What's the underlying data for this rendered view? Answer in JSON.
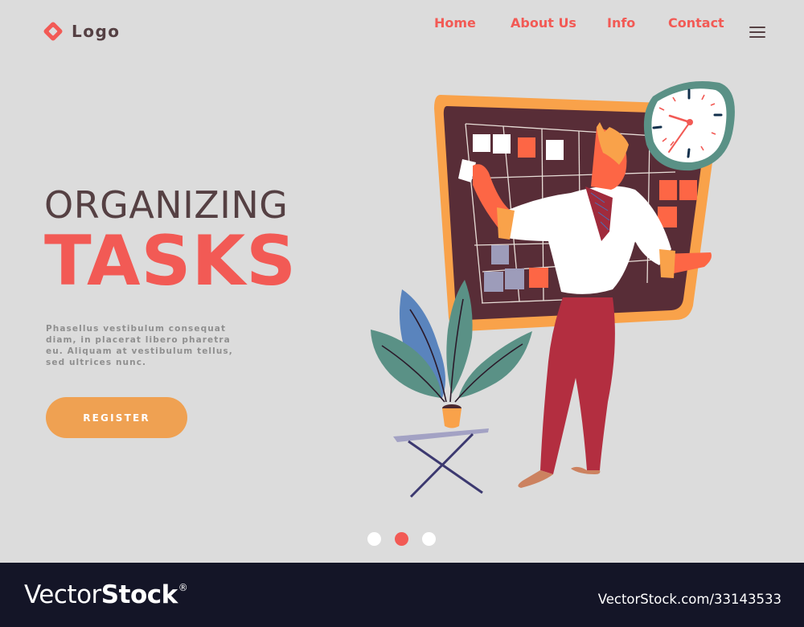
{
  "header": {
    "logo_text": "Logo",
    "nav": [
      {
        "label": "Home"
      },
      {
        "label": "About Us"
      },
      {
        "label": "Info"
      },
      {
        "label": "Contact"
      }
    ],
    "menu_icon": "hamburger-menu-icon"
  },
  "hero": {
    "title_line1": "ORGANIZING",
    "title_line2": "TASKS",
    "description": "Phasellus vestibulum consequat diam, in placerat libero pharetra eu. Aliquam at vestibulum tellus, sed ultrices nunc.",
    "cta_label": "REGISTER"
  },
  "carousel": {
    "slides": 3,
    "active_index": 1
  },
  "illustration": {
    "subject": "man arranging sticky notes on a task board next to a wall clock and potted plant",
    "clock_time": "approximately 8:35"
  },
  "footer": {
    "brand_light": "Vector",
    "brand_bold": "Stock",
    "brand_mark": "®",
    "image_id_text": "VectorStock.com/33143533"
  },
  "colors": {
    "background": "#dcdcdc",
    "accent": "#f25a55",
    "dark_text": "#554043",
    "button": "#efa152",
    "footer_bg": "#141527"
  }
}
